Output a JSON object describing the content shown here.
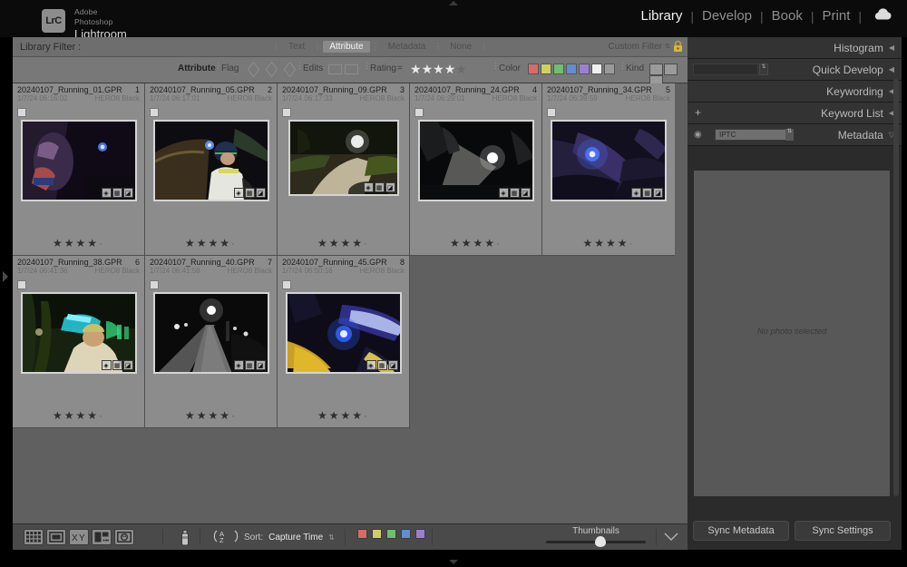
{
  "app": {
    "brand_sub": "Adobe Photoshop",
    "brand_main": "Lightroom Classic",
    "logo_text": "LrC"
  },
  "modules": {
    "items": [
      {
        "label": "Library",
        "active": true
      },
      {
        "label": "Develop",
        "active": false
      },
      {
        "label": "Book",
        "active": false
      },
      {
        "label": "Print",
        "active": false
      }
    ],
    "separator": "|",
    "cloud_icon": "cloud-icon"
  },
  "library_filter": {
    "label": "Library Filter :",
    "tabs": [
      {
        "label": "Text",
        "active": false
      },
      {
        "label": "Attribute",
        "active": true
      },
      {
        "label": "Metadata",
        "active": false
      },
      {
        "label": "None",
        "active": false
      }
    ],
    "custom_filter_label": "Custom Filter",
    "custom_filter_arrows": ":",
    "lock_icon": "lock-icon"
  },
  "attribute_bar": {
    "attribute_label": "Attribute",
    "flag_label": "Flag",
    "flag_icons": [
      "flag-pick-icon",
      "flag-unflagged-icon",
      "flag-reject-icon"
    ],
    "edits_label": "Edits",
    "edits_icons": [
      "edited-icon",
      "unedited-icon"
    ],
    "rating_label": "Rating",
    "rating_operator": "=",
    "rating_value": 4,
    "rating_max": 5,
    "color_label": "Color",
    "color_swatches": [
      "#d96a6a",
      "#cfcf63",
      "#6fbf6f",
      "#5f8fd0",
      "#9a7fd0",
      "#f0f0f0",
      "#9a9a9a"
    ],
    "kind_label": "Kind",
    "kind_icons": [
      "master-photo-icon",
      "virtual-copy-icon",
      "video-icon"
    ]
  },
  "grid": {
    "columns": 5,
    "photos": [
      {
        "name": "20240107_Running_01.GPR",
        "index": "1",
        "date": "1/7/24 06:16:02",
        "camera": "HERO8 Black",
        "rating": 4,
        "badges": [
          "keyword-icon",
          "crop-icon",
          "develop-icon"
        ]
      },
      {
        "name": "20240107_Running_05.GPR",
        "index": "2",
        "date": "1/7/24 06:17:01",
        "camera": "HERO8 Black",
        "rating": 4,
        "badges": [
          "keyword-icon",
          "crop-icon",
          "develop-icon"
        ]
      },
      {
        "name": "20240107_Running_09.GPR",
        "index": "3",
        "date": "1/7/24 06:17:33",
        "camera": "HERO8 Black",
        "rating": 4,
        "badges": [
          "keyword-icon",
          "crop-icon",
          "develop-icon"
        ]
      },
      {
        "name": "20240107_Running_24.GPR",
        "index": "4",
        "date": "1/7/24 06:29:01",
        "camera": "HERO8 Black",
        "rating": 4,
        "badges": [
          "keyword-icon",
          "crop-icon",
          "develop-icon"
        ]
      },
      {
        "name": "20240107_Running_34.GPR",
        "index": "5",
        "date": "1/7/24 06:39:59",
        "camera": "HERO8 Black",
        "rating": 4,
        "badges": [
          "keyword-icon",
          "crop-icon",
          "develop-icon"
        ]
      },
      {
        "name": "20240107_Running_38.GPR",
        "index": "6",
        "date": "1/7/24 06:41:36",
        "camera": "HERO8 Black",
        "rating": 4,
        "badges": [
          "keyword-icon",
          "crop-icon",
          "develop-icon"
        ]
      },
      {
        "name": "20240107_Running_40.GPR",
        "index": "7",
        "date": "1/7/24 06:41:58",
        "camera": "HERO8 Black",
        "rating": 4,
        "badges": [
          "keyword-icon",
          "crop-icon",
          "develop-icon"
        ]
      },
      {
        "name": "20240107_Running_45.GPR",
        "index": "8",
        "date": "1/7/24 06:50:16",
        "camera": "HERO8 Black",
        "rating": 4,
        "badges": [
          "keyword-icon",
          "crop-icon",
          "develop-icon"
        ]
      }
    ]
  },
  "toolbar": {
    "view_modes": [
      "grid-view-icon",
      "loupe-view-icon",
      "compare-view-icon",
      "survey-view-icon",
      "people-view-icon"
    ],
    "painter_icon": "spray-can-icon",
    "sort_icon": "sort-az-icon",
    "sort_label": "Sort:",
    "sort_value": "Capture Time",
    "sort_arrows": ":",
    "color_swatches": [
      "#d96a6a",
      "#cfcf63",
      "#6fbf6f",
      "#5f8fd0",
      "#9a7fd0"
    ],
    "thumbnails_label": "Thumbnails",
    "thumbnails_value": 50,
    "toolbar_toggle_icon": "chevron-down-icon"
  },
  "right_panel": {
    "panels": [
      {
        "title": "Histogram",
        "arrow": "◀"
      },
      {
        "title": "Quick Develop",
        "arrow": "◀"
      },
      {
        "title": "Keywording",
        "arrow": "◀"
      },
      {
        "title": "Keyword List",
        "arrow": "◀"
      },
      {
        "title": "Metadata",
        "arrow": "▽"
      }
    ],
    "keyword_list_plus": "+",
    "metadata_eye_icon": "eye-icon",
    "metadata_preset": "IPTC",
    "metadata_empty_text": "No photo selected",
    "sync_metadata_label": "Sync Metadata",
    "sync_settings_label": "Sync Settings"
  },
  "left_panel": {
    "collapse_icon": "triangle-right-icon"
  }
}
